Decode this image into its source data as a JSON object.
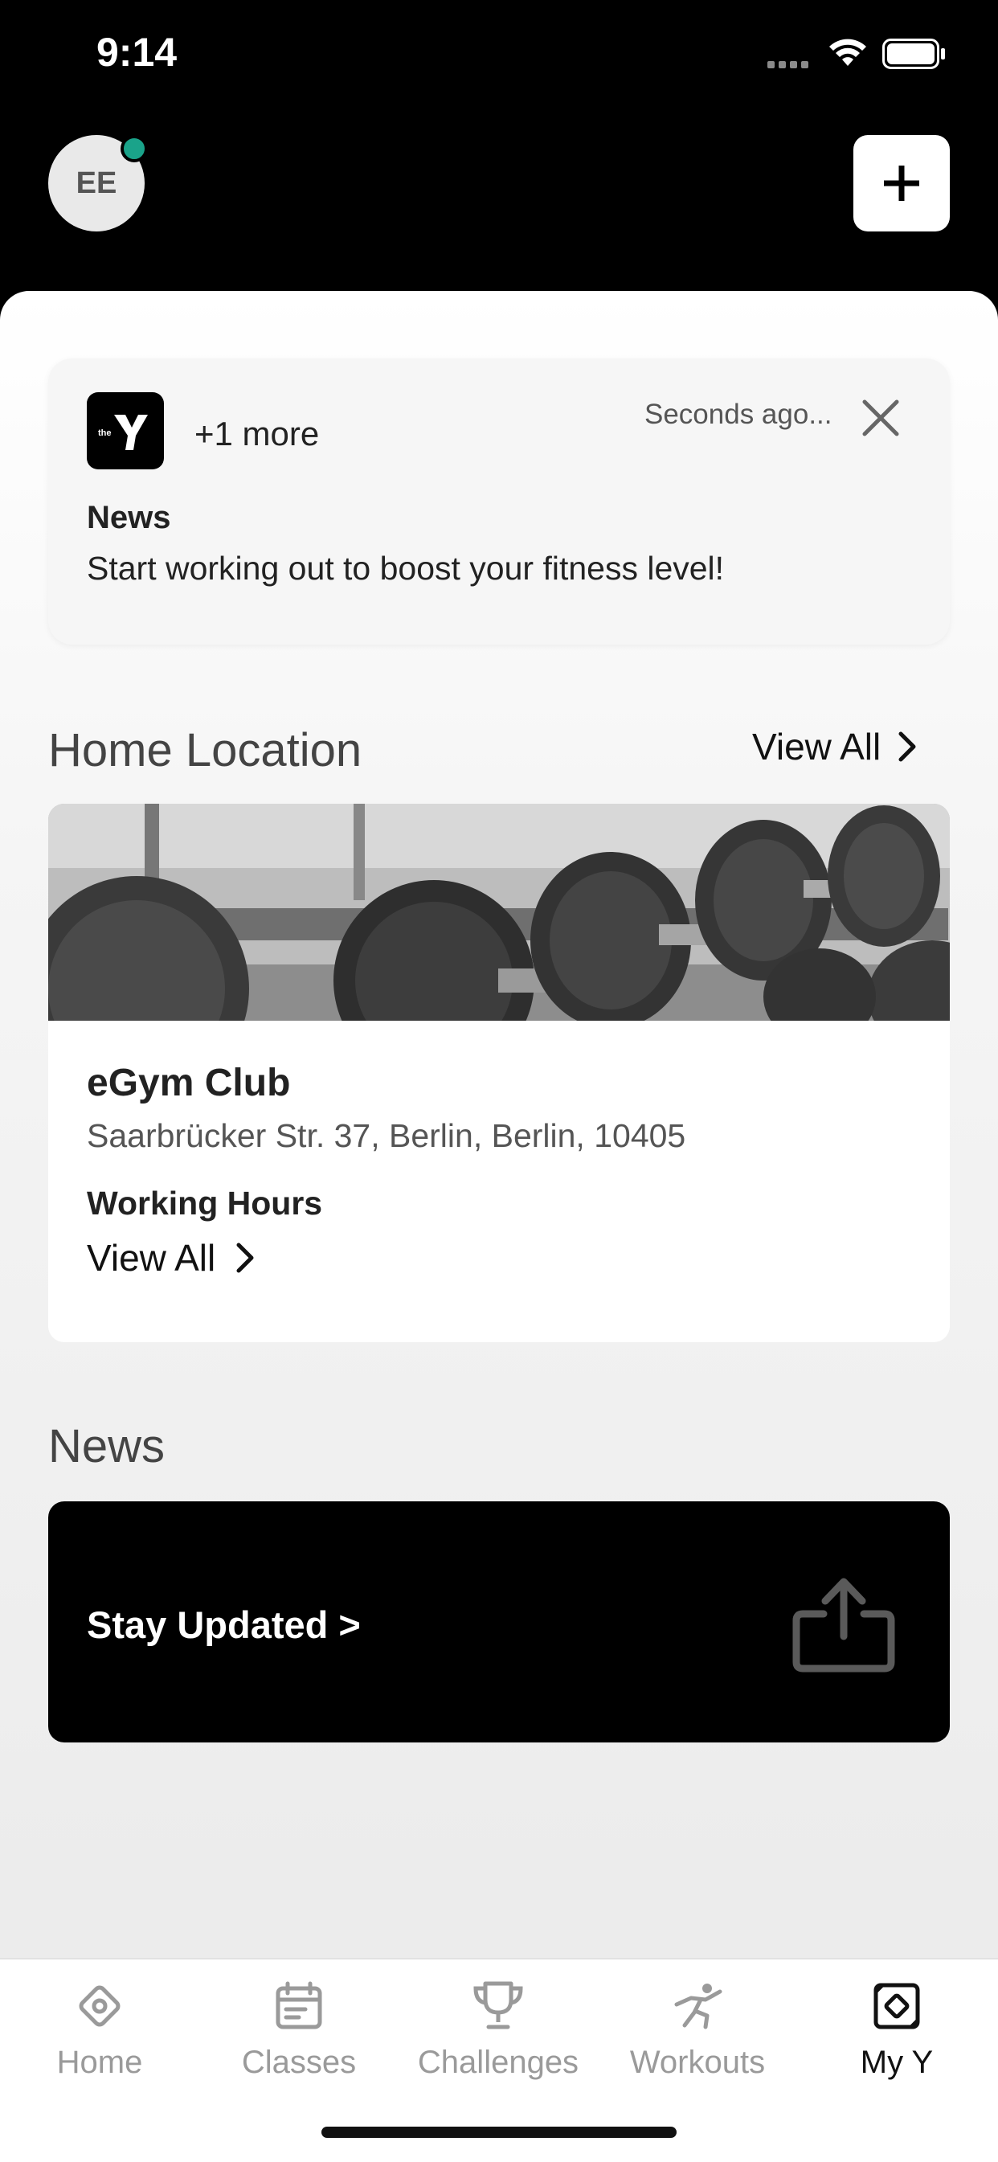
{
  "status_bar": {
    "time": "9:14"
  },
  "header": {
    "avatar_initials": "EE"
  },
  "notification": {
    "more": "+1 more",
    "time": "Seconds ago...",
    "title": "News",
    "body": "Start working out to boost your fitness level!",
    "logo_text": "the"
  },
  "home_location": {
    "title": "Home Location",
    "view_all": "View All",
    "club_name": "eGym Club",
    "address": "Saarbrücker Str. 37, Berlin, Berlin, 10405",
    "hours_label": "Working Hours",
    "hours_view_all": "View All"
  },
  "news": {
    "title": "News",
    "card_label": "Stay Updated >"
  },
  "tabs": [
    {
      "label": "Home",
      "icon": "home-icon"
    },
    {
      "label": "Classes",
      "icon": "calendar-icon"
    },
    {
      "label": "Challenges",
      "icon": "trophy-icon"
    },
    {
      "label": "Workouts",
      "icon": "running-icon"
    },
    {
      "label": "My Y",
      "icon": "my-y-icon",
      "active": true
    }
  ],
  "colors": {
    "online_dot": "#1aa38a",
    "background_dark": "#000000",
    "tab_active": "#111111",
    "tab_inactive": "#9a9a9a"
  }
}
